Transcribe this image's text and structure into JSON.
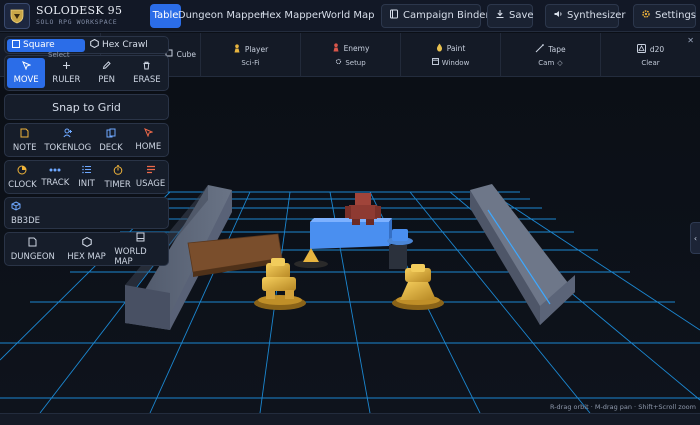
{
  "app": {
    "title": "SOLODESK 95",
    "subtitle": "SOLO RPG WORKSPACE"
  },
  "nav": {
    "tabs": [
      {
        "label": "Table",
        "active": true
      },
      {
        "label": "Dungeon Mapper",
        "active": false
      },
      {
        "label": "Hex Mapper",
        "active": false
      },
      {
        "label": "World Map",
        "active": false
      }
    ],
    "campaign_binder": "Campaign Binder",
    "save": "Save",
    "synthesizer": "Synthesizer",
    "settings": "Settings"
  },
  "toolbar": {
    "select": "Select",
    "cube": "Cube",
    "player": "Player",
    "enemy": "Enemy",
    "paint": "Paint",
    "tape": "Tape",
    "d20": "d20",
    "scifi": "Sci-Fi",
    "setup": "Setup",
    "window": "Window",
    "cam": "Cam",
    "clear": "Clear"
  },
  "palette": {
    "shape_square": "Square",
    "shape_hex": "Hex Crawl",
    "tools_row1": [
      {
        "label": "MOVE",
        "icon": "cursor-icon",
        "active": true
      },
      {
        "label": "RULER",
        "icon": "plus-icon",
        "active": false
      },
      {
        "label": "PEN",
        "icon": "pen-icon",
        "active": false
      },
      {
        "label": "ERASE",
        "icon": "trash-icon",
        "active": false
      }
    ],
    "snap": "Snap to Grid",
    "tools_row2": [
      {
        "label": "NOTE",
        "icon": "note-icon"
      },
      {
        "label": "TOKENLOG",
        "icon": "token-log-icon"
      },
      {
        "label": "DECK",
        "icon": "deck-icon"
      },
      {
        "label": "HOME",
        "icon": "home-cursor-icon"
      }
    ],
    "tools_row3": [
      {
        "label": "CLOCK",
        "icon": "clock-icon"
      },
      {
        "label": "TRACK",
        "icon": "track-icon"
      },
      {
        "label": "INIT",
        "icon": "list-icon"
      },
      {
        "label": "TIMER",
        "icon": "timer-icon"
      },
      {
        "label": "USAGE",
        "icon": "usage-icon"
      }
    ],
    "bb3de": "BB3DE",
    "tools_row4": [
      {
        "label": "DUNGEON",
        "icon": "dungeon-doc-icon"
      },
      {
        "label": "HEX MAP",
        "icon": "hexagon-icon"
      },
      {
        "label": "WORLD MAP",
        "icon": "world-map-icon"
      }
    ]
  },
  "stage": {
    "hint": "R-drag orbit · M-drag pan · Shift+Scroll zoom"
  },
  "colors": {
    "accent": "#2b6de8",
    "grid": "#1aa3ff",
    "token_gold": "#e7b43f",
    "enemy_red": "#a0443a",
    "cube_blue": "#4a8ff0"
  }
}
